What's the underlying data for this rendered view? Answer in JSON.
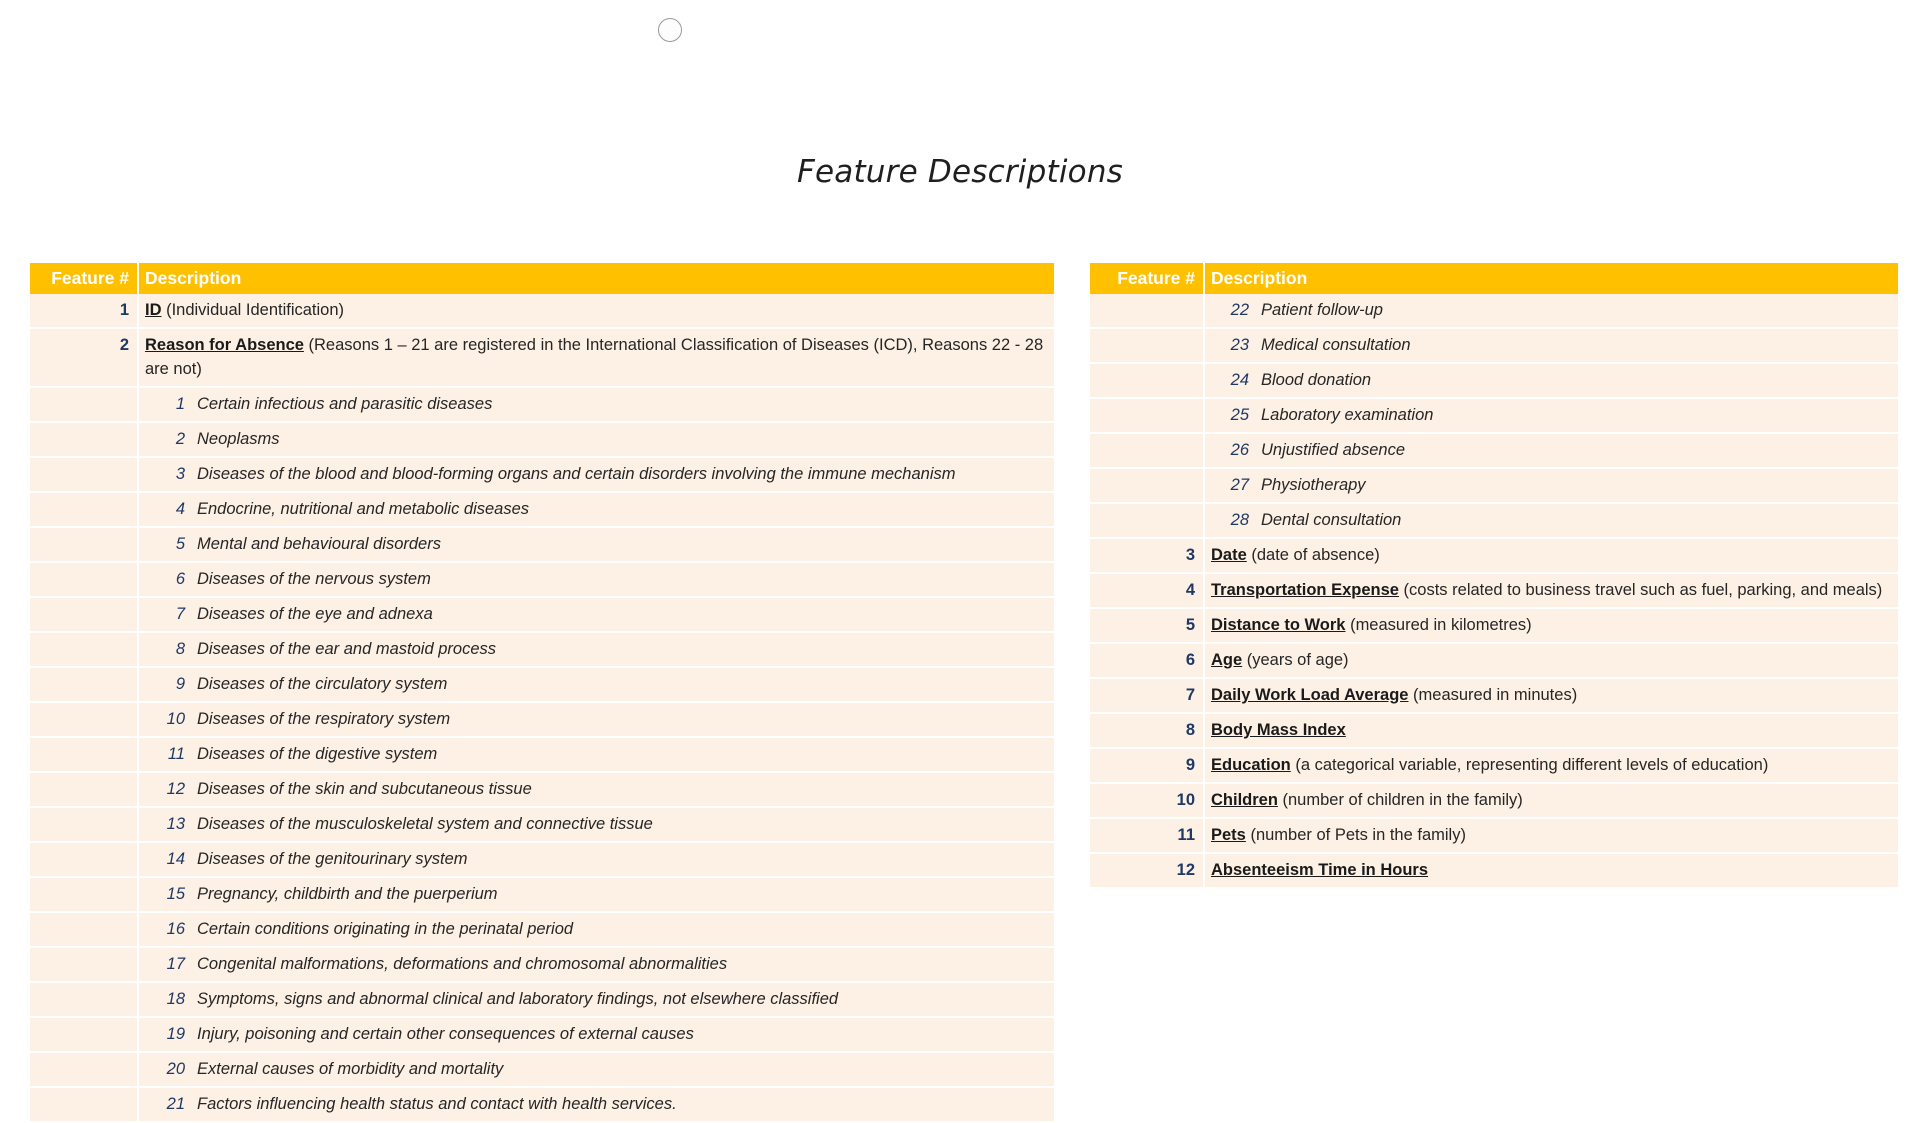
{
  "page": {
    "title": "Feature Descriptions"
  },
  "headers": {
    "feature_num": "Feature #",
    "description": "Description"
  },
  "left_table": {
    "feature_1": {
      "num": "1",
      "name": "ID",
      "desc": " (Individual Identification)"
    },
    "feature_2": {
      "num": "2",
      "name": "Reason for Absence",
      "desc": " (Reasons 1 – 21 are registered in the International Classification of Diseases (ICD), Reasons 22 - 28 are not)"
    },
    "reasons": [
      {
        "num": "1",
        "text": "Certain infectious and parasitic diseases"
      },
      {
        "num": "2",
        "text": "Neoplasms"
      },
      {
        "num": "3",
        "text": "Diseases of the blood and blood-forming organs and certain disorders involving the immune mechanism"
      },
      {
        "num": "4",
        "text": "Endocrine, nutritional and metabolic diseases"
      },
      {
        "num": "5",
        "text": "Mental and behavioural disorders"
      },
      {
        "num": "6",
        "text": "Diseases of the nervous system"
      },
      {
        "num": "7",
        "text": "Diseases of the eye and adnexa"
      },
      {
        "num": "8",
        "text": "Diseases of the ear and mastoid process"
      },
      {
        "num": "9",
        "text": "Diseases of the circulatory system"
      },
      {
        "num": "10",
        "text": "Diseases of the respiratory system"
      },
      {
        "num": "11",
        "text": "Diseases of the digestive system"
      },
      {
        "num": "12",
        "text": "Diseases of the skin and subcutaneous tissue"
      },
      {
        "num": "13",
        "text": "Diseases of the musculoskeletal system and connective tissue"
      },
      {
        "num": "14",
        "text": "Diseases of the genitourinary system"
      },
      {
        "num": "15",
        "text": "Pregnancy, childbirth and the puerperium"
      },
      {
        "num": "16",
        "text": "Certain conditions originating in the perinatal period"
      },
      {
        "num": "17",
        "text": "Congenital malformations, deformations and chromosomal abnormalities"
      },
      {
        "num": "18",
        "text": "Symptoms, signs and abnormal clinical and laboratory findings, not elsewhere classified"
      },
      {
        "num": "19",
        "text": "Injury, poisoning and certain other consequences of external causes"
      },
      {
        "num": "20",
        "text": "External causes of morbidity and mortality"
      },
      {
        "num": "21",
        "text": "Factors influencing health status and contact with health services."
      }
    ]
  },
  "right_table": {
    "reasons": [
      {
        "num": "22",
        "text": "Patient follow-up"
      },
      {
        "num": "23",
        "text": "Medical consultation"
      },
      {
        "num": "24",
        "text": "Blood donation"
      },
      {
        "num": "25",
        "text": "Laboratory examination"
      },
      {
        "num": "26",
        "text": "Unjustified absence"
      },
      {
        "num": "27",
        "text": "Physiotherapy"
      },
      {
        "num": "28",
        "text": "Dental consultation"
      }
    ],
    "features": [
      {
        "num": "3",
        "name": "Date",
        "desc": " (date of absence)"
      },
      {
        "num": "4",
        "name": "Transportation Expense",
        "desc": " (costs related to business travel such as fuel, parking, and meals)"
      },
      {
        "num": "5",
        "name": "Distance to Work",
        "desc": " (measured in kilometres)"
      },
      {
        "num": "6",
        "name": "Age",
        "desc": " (years of age)"
      },
      {
        "num": "7",
        "name": "Daily Work Load Average",
        "desc": " (measured in minutes)"
      },
      {
        "num": "8",
        "name": "Body Mass Index",
        "desc": ""
      },
      {
        "num": "9",
        "name": "Education",
        "desc": " (a categorical variable, representing different levels of education)"
      },
      {
        "num": "10",
        "name": "Children",
        "desc": " (number of children in the family)"
      },
      {
        "num": "11",
        "name": "Pets",
        "desc": " (number of Pets in the family)"
      },
      {
        "num": "12",
        "name": "Absenteeism Time in Hours",
        "desc": ""
      }
    ]
  }
}
